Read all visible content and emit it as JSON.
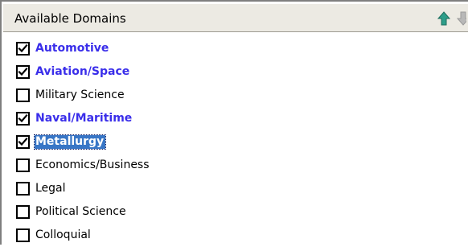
{
  "header": {
    "title": "Available Domains",
    "move_up_icon": "arrow-up-icon",
    "move_down_icon": "arrow-down-icon",
    "up_color": "#2e9e8a",
    "down_color": "#b0b0b0"
  },
  "colors": {
    "checked_text": "#3a2eea",
    "selection_background": "#3876c6"
  },
  "domains": [
    {
      "label": "Automotive",
      "checked": true,
      "selected": false
    },
    {
      "label": "Aviation/Space",
      "checked": true,
      "selected": false
    },
    {
      "label": "Military Science",
      "checked": false,
      "selected": false
    },
    {
      "label": "Naval/Maritime",
      "checked": true,
      "selected": false
    },
    {
      "label": "Metallurgy",
      "checked": true,
      "selected": true
    },
    {
      "label": "Economics/Business",
      "checked": false,
      "selected": false
    },
    {
      "label": "Legal",
      "checked": false,
      "selected": false
    },
    {
      "label": "Political Science",
      "checked": false,
      "selected": false
    },
    {
      "label": "Colloquial",
      "checked": false,
      "selected": false
    }
  ]
}
